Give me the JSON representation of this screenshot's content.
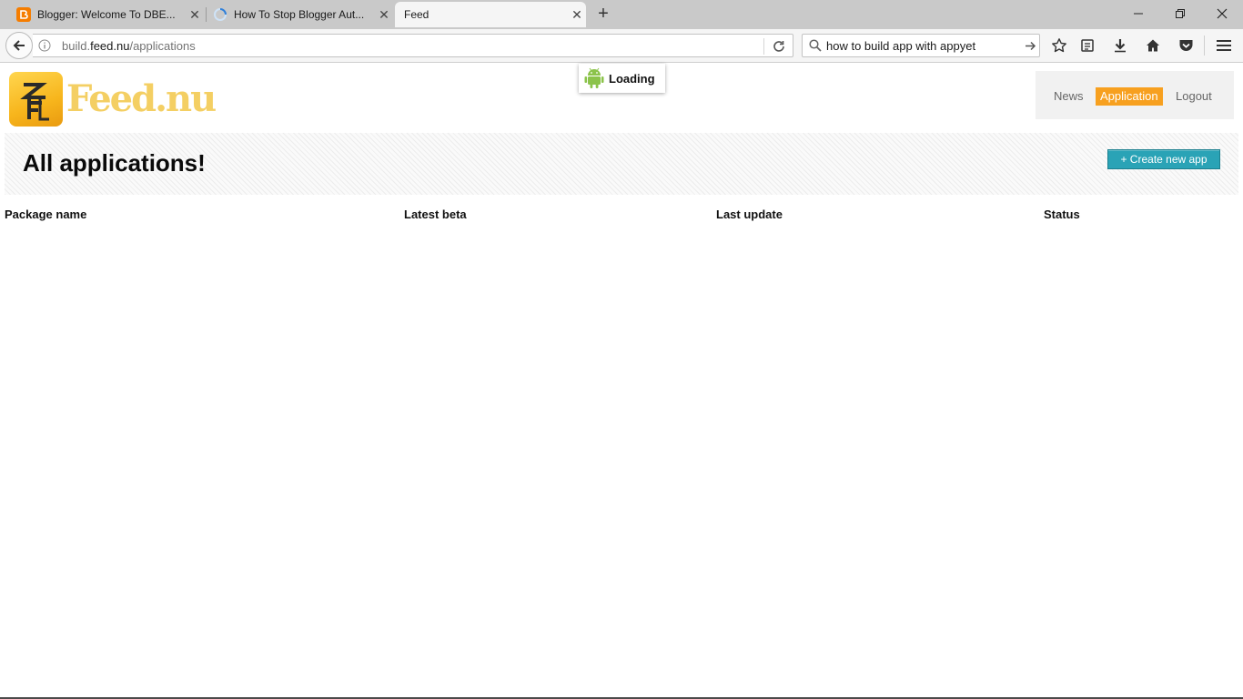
{
  "browser": {
    "tabs": [
      {
        "title": "Blogger: Welcome To DBE...",
        "active": false
      },
      {
        "title": "How To Stop Blogger Aut...",
        "active": false
      },
      {
        "title": "Feed",
        "active": true
      }
    ],
    "address": {
      "prefix": "build.",
      "domain": "feed.nu",
      "path": "/applications"
    },
    "search": {
      "value": "how to build app with appyet"
    },
    "colors": {
      "tabbar": "#c9c9c9",
      "toolbar": "#f5f5f5"
    }
  },
  "page": {
    "logo_text": "Feed.nu",
    "loading_text": "Loading",
    "nav": {
      "news": "News",
      "application": "Application",
      "logout": "Logout",
      "active": "Application"
    },
    "heading": "All applications!",
    "create_button": "+ Create new app",
    "columns": [
      "Package name",
      "Latest beta",
      "Last update",
      "Status"
    ],
    "colors": {
      "accent": "#f7a01f",
      "button": "#2aa3b6",
      "android": "#8bc34a"
    }
  }
}
